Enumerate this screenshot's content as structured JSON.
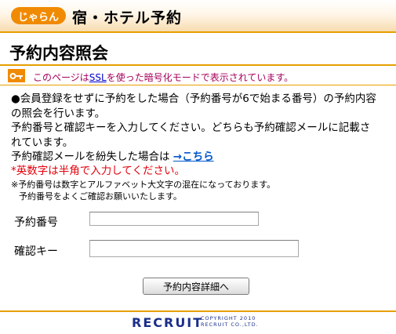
{
  "header": {
    "logo_text": "じゃらん",
    "title": "宿・ホテル予約"
  },
  "page": {
    "title": "予約内容照会"
  },
  "ssl_notice": {
    "prefix": "このページは",
    "link": "SSL",
    "suffix": "を使った暗号化モードで表示されています。"
  },
  "instructions": {
    "line1": "●会員登録をせずに予約をした場合（予約番号が6で始まる番号）の予約内容の照会を行います。",
    "line2": "予約番号と確認キーを入力してください。どちらも予約確認メールに記載されています。",
    "lost_prefix": "予約確認メールを紛失した場合は ",
    "lost_link": "→こちら",
    "warning": "*英数字は半角で入力してください。"
  },
  "note": {
    "line1": "※予約番号は数字とアルファベット大文字の混在になっております。",
    "line2": "予約番号をよくご確認お願いいたします。"
  },
  "form": {
    "reservation_number_label": "予約番号",
    "reservation_number_value": "",
    "confirmation_key_label": "確認キー",
    "confirmation_key_value": "",
    "submit_label": "予約内容詳細へ"
  },
  "footer": {
    "logo": "RECRUIT",
    "copyright_line1": "COPYRIGHT 2010",
    "copyright_line2": "RECRUIT CO.,LTD."
  },
  "colors": {
    "accent_orange": "#f08a00",
    "ssl_text": "#a5005a",
    "warning_red": "#e3000b",
    "recruit_blue": "#1a2e8a"
  },
  "icons": {
    "ssl": "key-icon"
  }
}
